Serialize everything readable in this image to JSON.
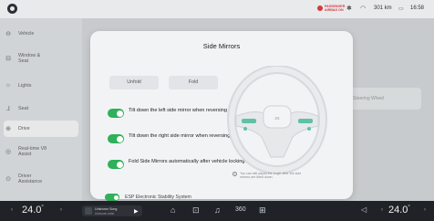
{
  "status": {
    "airbag_line1": "PASSENGER",
    "airbag_line2": "AIRBAG ON",
    "range": "301 km",
    "time": "16:58"
  },
  "sidebar": {
    "items": [
      {
        "label": "Vehicle",
        "icon": "car-icon"
      },
      {
        "label": "Window & Seat",
        "icon": "seat-icon"
      },
      {
        "label": "Lights",
        "icon": "light-icon"
      },
      {
        "label": "Seat",
        "icon": "seat-adjust-icon"
      },
      {
        "label": "Drive",
        "icon": "steering-icon"
      },
      {
        "label": "Real-time V8 Assist",
        "icon": "assist-icon"
      },
      {
        "label": "Driver Assistance",
        "icon": "driver-assist-icon"
      }
    ]
  },
  "background": {
    "card_label": "Steering Wheel"
  },
  "modal": {
    "title": "Side Mirrors",
    "unfold_label": "Unfold",
    "fold_label": "Fold",
    "options": [
      {
        "label": "Tilt down the left side mirror when reversing",
        "on": true
      },
      {
        "label": "Tilt down the right side mirror when reversing",
        "on": true
      },
      {
        "label": "Fold Side Mirrors automatically after vehicle locking",
        "on": true
      }
    ],
    "info_text": "You can still adjust the angle after the side mirrors are tilted down."
  },
  "esp": {
    "label": "ESP Electronic Stability System"
  },
  "bottom": {
    "left_temp": "24.0",
    "right_temp": "24.0",
    "temp_unit": "°",
    "music_title": "Unknown Song",
    "music_sub": "Unknown artist"
  },
  "colors": {
    "toggle_on": "#2fb05a",
    "accent_teal": "#5fc1a5"
  }
}
